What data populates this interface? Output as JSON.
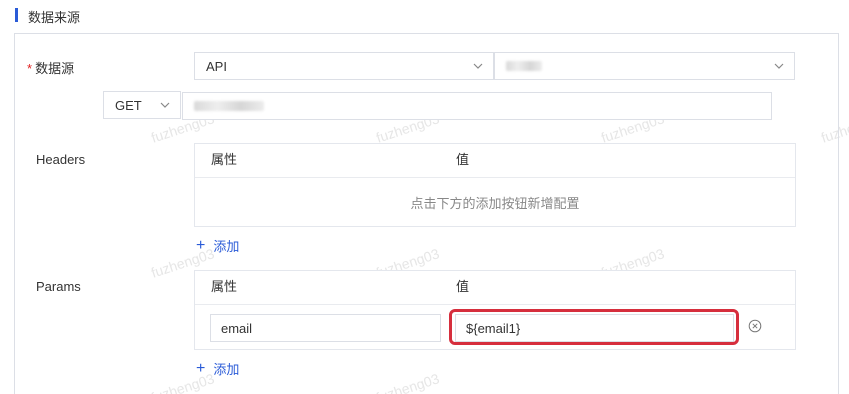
{
  "section": {
    "title": "数据来源"
  },
  "datasource": {
    "required_mark": "*",
    "label": "数据源",
    "type_value": "API",
    "source_value": ""
  },
  "request": {
    "method": "GET",
    "url_value": ""
  },
  "headers": {
    "label": "Headers",
    "col_attr": "属性",
    "col_value": "值",
    "empty_text": "点击下方的添加按钮新增配置",
    "add_label": "添加"
  },
  "params": {
    "label": "Params",
    "col_attr": "属性",
    "col_value": "值",
    "rows": [
      {
        "attr": "email",
        "value": "${email1}"
      }
    ],
    "add_label": "添加"
  },
  "watermark": {
    "text": "fuzheng03"
  },
  "colors": {
    "accent": "#2a5bd7",
    "highlight": "#d62e3d",
    "border": "#dcdfe6"
  },
  "icons": [
    "chevron-down-icon",
    "plus-icon",
    "remove-circle-icon"
  ]
}
